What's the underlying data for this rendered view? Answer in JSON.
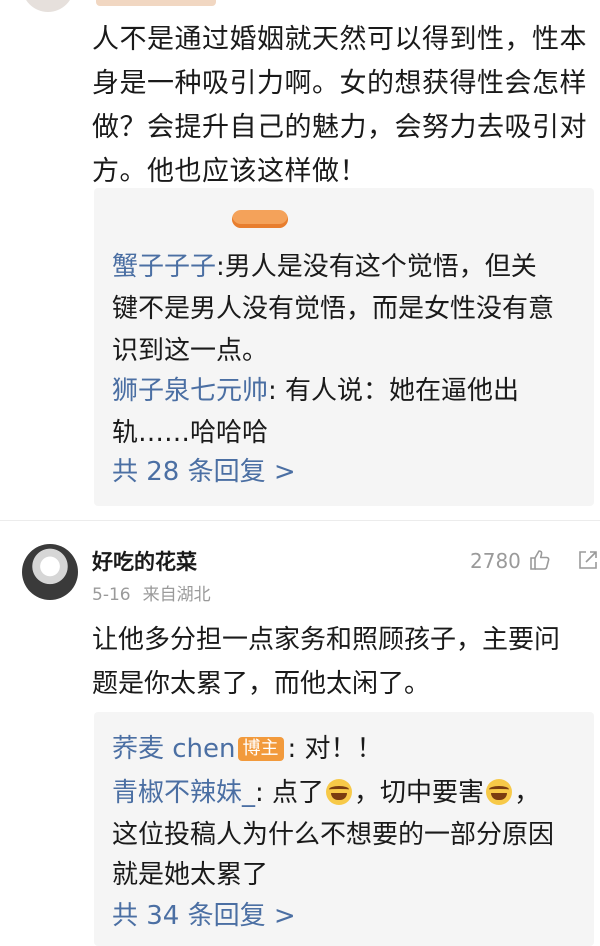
{
  "comment1": {
    "lines": [
      "人不是通过婚姻就天然可以得到性，性本",
      "身是一种吸引力啊。女的想获得性会怎样",
      "做？会提升自己的魅力，会努力去吸引对",
      "方。他也应该这样做！"
    ],
    "replies": [
      {
        "nickname": "蟹子子子",
        "separator": ":",
        "lines": [
          "男人是没有这个觉悟，但关",
          "键不是男人没有觉悟，而是女性没有意",
          "识到这一点。"
        ]
      },
      {
        "nickname": "狮子泉七元帅",
        "separator": ":",
        "lines": [
          " 有人说：她在逼他出",
          "轨……哈哈哈"
        ]
      }
    ],
    "more_replies": "共 28 条回复 >"
  },
  "comment2": {
    "author": "好吃的花菜",
    "date": "5-16",
    "location": "来自湖北",
    "likes": "2780",
    "lines": [
      "让他多分担一点家务和照顾孩子，主要问",
      "题是你太累了，而他太闲了。"
    ],
    "replies": [
      {
        "nickname": "荞麦 chen",
        "badge": "博主",
        "separator": ":",
        "text": " 对！！"
      },
      {
        "nickname": "青椒不辣妹_",
        "separator": ":",
        "line1_a": " 点了",
        "line1_b": "，切中要害",
        "line1_c": "，",
        "lines": [
          "这位投稿人为什么不想要的一部分原因",
          "就是她太累了"
        ]
      }
    ],
    "more_replies": "共 34 条回复 >"
  },
  "icons": {
    "like": "thumbs-up-icon",
    "share": "share-icon",
    "emoji": "laughing-tears-emoji"
  },
  "colors": {
    "nickname": "#4b6fa3",
    "badge": "#f29a3c",
    "meta": "#9a9a9a",
    "reply_bg": "#f5f5f5"
  }
}
